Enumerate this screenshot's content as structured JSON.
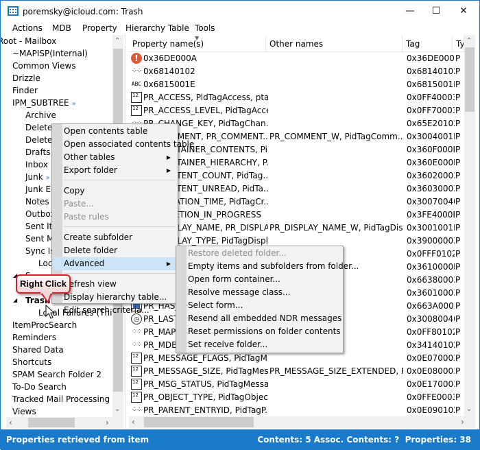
{
  "window": {
    "title": "poremsky@icloud.com: Trash",
    "minimize": "—",
    "maximize": "☐",
    "close": "✕"
  },
  "menubar": [
    "Actions",
    "MDB",
    "Property",
    "Hierarchy Table",
    "Tools"
  ],
  "tree": [
    {
      "label": "Root - Mailbox",
      "indent": 0
    },
    {
      "label": "~MAPISP(Internal)",
      "indent": 1
    },
    {
      "label": "Common Views",
      "indent": 1
    },
    {
      "label": "Drizzle",
      "indent": 1
    },
    {
      "label": "Finder",
      "indent": 1
    },
    {
      "label": "IPM_SUBTREE",
      "indent": 1,
      "badge": "»"
    },
    {
      "label": "Archive",
      "indent": 2
    },
    {
      "label": "Deleted",
      "indent": 2
    },
    {
      "label": "Deleted",
      "indent": 2
    },
    {
      "label": "Drafts",
      "indent": 2
    },
    {
      "label": "Inbox",
      "indent": 2
    },
    {
      "label": "Junk",
      "indent": 2,
      "badge": "»"
    },
    {
      "label": "Junk E-",
      "indent": 2
    },
    {
      "label": "Notes",
      "indent": 2
    },
    {
      "label": "Outbox",
      "indent": 2
    },
    {
      "label": "Sent Items",
      "indent": 2
    },
    {
      "label": "Sent M",
      "indent": 2
    },
    {
      "label": "Sync Issues",
      "indent": 2
    },
    {
      "label": "Loc",
      "indent": 3
    },
    {
      "label": "S",
      "indent": 2,
      "expander": "◢"
    },
    {
      "label": "",
      "indent": 2
    },
    {
      "label": "Trash",
      "indent": 2,
      "expander": "◢",
      "selected": true
    },
    {
      "label": "Local Failures (This c",
      "indent": 3
    },
    {
      "label": "ItemProcSearch",
      "indent": 1
    },
    {
      "label": "Reminders",
      "indent": 1
    },
    {
      "label": "Shared Data",
      "indent": 1
    },
    {
      "label": "Shortcuts",
      "indent": 1
    },
    {
      "label": "SPAM Search Folder 2",
      "indent": 1
    },
    {
      "label": "To-Do Search",
      "indent": 1
    },
    {
      "label": "Tracked Mail Processing",
      "indent": 1
    },
    {
      "label": "Views",
      "indent": 1
    }
  ],
  "columns": {
    "name": "Property name(s)",
    "other": "Other names",
    "tag": "Tag",
    "type": "Ty"
  },
  "rows": [
    {
      "icon": "error",
      "name": "0x36DE000A",
      "other": "",
      "tag": "0x36DE000A",
      "type": "P"
    },
    {
      "icon": "binary",
      "name": "0x68140102",
      "other": "",
      "tag": "0x68140102",
      "type": "P"
    },
    {
      "icon": "string",
      "name": "0x6815001E",
      "other": "",
      "tag": "0x6815001E",
      "type": "P"
    },
    {
      "icon": "number",
      "name": "PR_ACCESS, PidTagAccess, pta...",
      "other": "",
      "tag": "0x0FF40003",
      "type": "P"
    },
    {
      "icon": "number",
      "name": "PR_ACCESS_LEVEL, PidTagAcce...",
      "other": "",
      "tag": "0x0FF70003",
      "type": "P"
    },
    {
      "icon": "binary",
      "name": "PR_CHANGE_KEY, PidTagChan...",
      "other": "",
      "tag": "0x65E20102",
      "type": "P"
    },
    {
      "icon": "string",
      "name": "PR_COMMENT, PR_COMMENT...",
      "other": "PR_COMMENT_W, PidTagComm...",
      "tag": "0x3004001E",
      "type": "P"
    },
    {
      "icon": "binary",
      "name": "PR_CONTAINER_CONTENTS, Pi...",
      "other": "",
      "tag": "0x360F000D",
      "type": "P"
    },
    {
      "icon": "binary",
      "name": "PR_CONTAINER_HIERARCHY, P...",
      "other": "",
      "tag": "0x360E000D",
      "type": "P"
    },
    {
      "icon": "number",
      "name": "PR_CONTENT_COUNT, PidTag...",
      "other": "",
      "tag": "0x36020003",
      "type": "P"
    },
    {
      "icon": "number",
      "name": "PR_CONTENT_UNREAD, PidTa...",
      "other": "",
      "tag": "0x36030003",
      "type": "P"
    },
    {
      "icon": "time",
      "name": "PR_CREATION_TIME, PidTagCr...",
      "other": "",
      "tag": "0x30070040",
      "type": "P"
    },
    {
      "icon": "bool",
      "name": "PR_DELETION_IN_PROGRESS",
      "other": "",
      "tag": "0x3FE4000B",
      "type": "P"
    },
    {
      "icon": "string",
      "name": "PR_DISPLAY_NAME, PR_DISPLA...",
      "other": "PR_DISPLAY_NAME_W, PidTagDis...",
      "tag": "0x3001001E",
      "type": "P"
    },
    {
      "icon": "number",
      "name": "PR_DISPLAY_TYPE, PidTagDispl...",
      "other": "",
      "tag": "0x39000003",
      "type": "P"
    },
    {
      "icon": "binary",
      "name": "PR_ENTRYID",
      "other": "",
      "tag": "0x0FFF0102",
      "type": "P"
    },
    {
      "icon": "binary",
      "name": "PR_",
      "other": "",
      "tag": "0x3610000D",
      "type": "P"
    },
    {
      "icon": "number",
      "name": "PR_",
      "other": "",
      "tag": "0x66380003",
      "type": "P"
    },
    {
      "icon": "number",
      "name": "PR_FOLDER_TYPE",
      "other": "",
      "tag": "0x36010003",
      "type": "P"
    },
    {
      "icon": "bool",
      "name": "PR_HAS_",
      "other": "THREAD_TIM...",
      "tag": "0x663A000B",
      "type": "P"
    },
    {
      "icon": "time",
      "name": "PR_LAST_",
      "other": "",
      "tag": "0x30080040",
      "type": "P"
    },
    {
      "icon": "binary",
      "name": "PR_MAPI",
      "other": "",
      "tag": "0x0FF80102",
      "type": "P"
    },
    {
      "icon": "binary",
      "name": "PR_MDB_",
      "other": "",
      "tag": "0x34140102",
      "type": "P"
    },
    {
      "icon": "number",
      "name": "PR_MESSAGE_FLAGS, PidTagM...",
      "other": "",
      "tag": "0x0E070003",
      "type": "P"
    },
    {
      "icon": "number",
      "name": "PR_MESSAGE_SIZE, PidTagMess...",
      "other": "PR_MESSAGE_SIZE_EXTENDED, Pi...",
      "tag": "0x0E080003",
      "type": "P"
    },
    {
      "icon": "number",
      "name": "PR_MSG_STATUS, PidTagMessa...",
      "other": "",
      "tag": "0x0E170003",
      "type": "P"
    },
    {
      "icon": "number",
      "name": "PR_OBJECT_TYPE, PidTagObjec...",
      "other": "",
      "tag": "0x0FFE0003",
      "type": "P"
    },
    {
      "icon": "binary",
      "name": "PR_PARENT_ENTRYID, PidTagP...",
      "other": "",
      "tag": "0x0E090102",
      "type": "P"
    }
  ],
  "context_menu": [
    {
      "label": "Open contents table"
    },
    {
      "label": "Open associated contents table"
    },
    {
      "label": "Other tables",
      "submenu": true
    },
    {
      "label": "Export folder",
      "submenu": true
    },
    {
      "separator": true
    },
    {
      "label": "Copy"
    },
    {
      "label": "Paste...",
      "disabled": true
    },
    {
      "label": "Paste rules",
      "disabled": true
    },
    {
      "separator": true
    },
    {
      "label": "Create subfolder"
    },
    {
      "label": "Delete folder"
    },
    {
      "label": "Advanced",
      "submenu": true,
      "highlighted": true
    },
    {
      "separator": true
    },
    {
      "label": "Refresh view"
    },
    {
      "label": "Display hierarchy table..."
    },
    {
      "label": "Edit search criteria..."
    }
  ],
  "advanced_submenu": [
    {
      "label": "Restore deleted folder...",
      "disabled": true
    },
    {
      "label": "Empty items and subfolders from folder..."
    },
    {
      "label": "Open form container..."
    },
    {
      "label": "Resolve message class..."
    },
    {
      "label": "Select form..."
    },
    {
      "label": "Resend all embedded NDR messages"
    },
    {
      "label": "Reset permissions on folder contents"
    },
    {
      "label": "Set receive folder..."
    }
  ],
  "callout": "Right Click",
  "status": {
    "left": "Properties retrieved from item",
    "right": "Contents: 5 Assoc. Contents: ?  Properties: 38"
  },
  "colors": {
    "accent": "#1979ca",
    "highlight": "#cce4f7",
    "callout_border": "#d2222a",
    "error_icon": "#e05a3a"
  }
}
